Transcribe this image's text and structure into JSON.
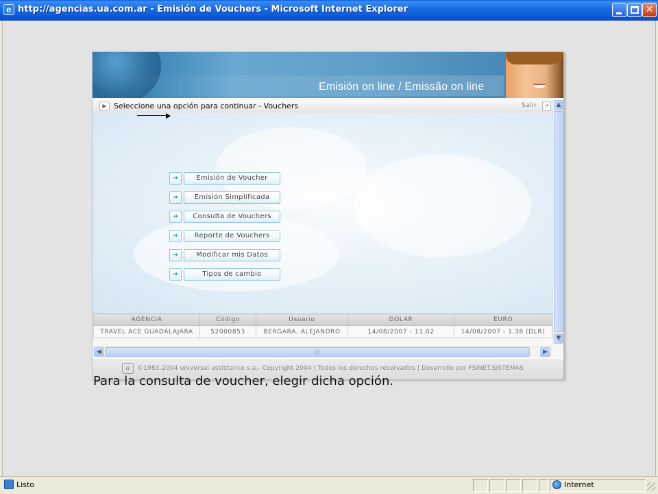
{
  "window": {
    "title": "http://agencias.ua.com.ar - Emisión de Vouchers - Microsoft Internet Explorer",
    "icon": "ie-page-icon"
  },
  "banner": {
    "heading": "Emisión on line / Emissão on line"
  },
  "crumbbar": {
    "text": "Seleccione una opción para continuar - Vouchers",
    "salir": "Salir"
  },
  "menu": {
    "items": [
      {
        "label": "Emisión de Voucher"
      },
      {
        "label": "Emisión Simplificada"
      },
      {
        "label": "Consulta de Vouchers"
      },
      {
        "label": "Reporte de Vouchers"
      },
      {
        "label": "Modificar mis Datos"
      },
      {
        "label": "Tipos de cambio"
      }
    ]
  },
  "info_table": {
    "headers": [
      "AGENCIA",
      "Código",
      "Usuario",
      "DOLAR",
      "EURO"
    ],
    "row": [
      "TRAVEL ACE GUADALAJARA",
      "52000853",
      "BERGARA, ALEJANDRO",
      "14/08/2007 - 11.02",
      "14/08/2007 - 1.38 (DLR)"
    ]
  },
  "footer": {
    "copyright": "©1983-2004 universal assistance s.a.- Copyright 2004 | Todos los derechos reservados | Desarrollo por FSINET.SISTEMAS"
  },
  "caption": "Para la consulta de voucher, elegir dicha opción.",
  "statusbar": {
    "status": "Listo",
    "zone": "Internet"
  }
}
